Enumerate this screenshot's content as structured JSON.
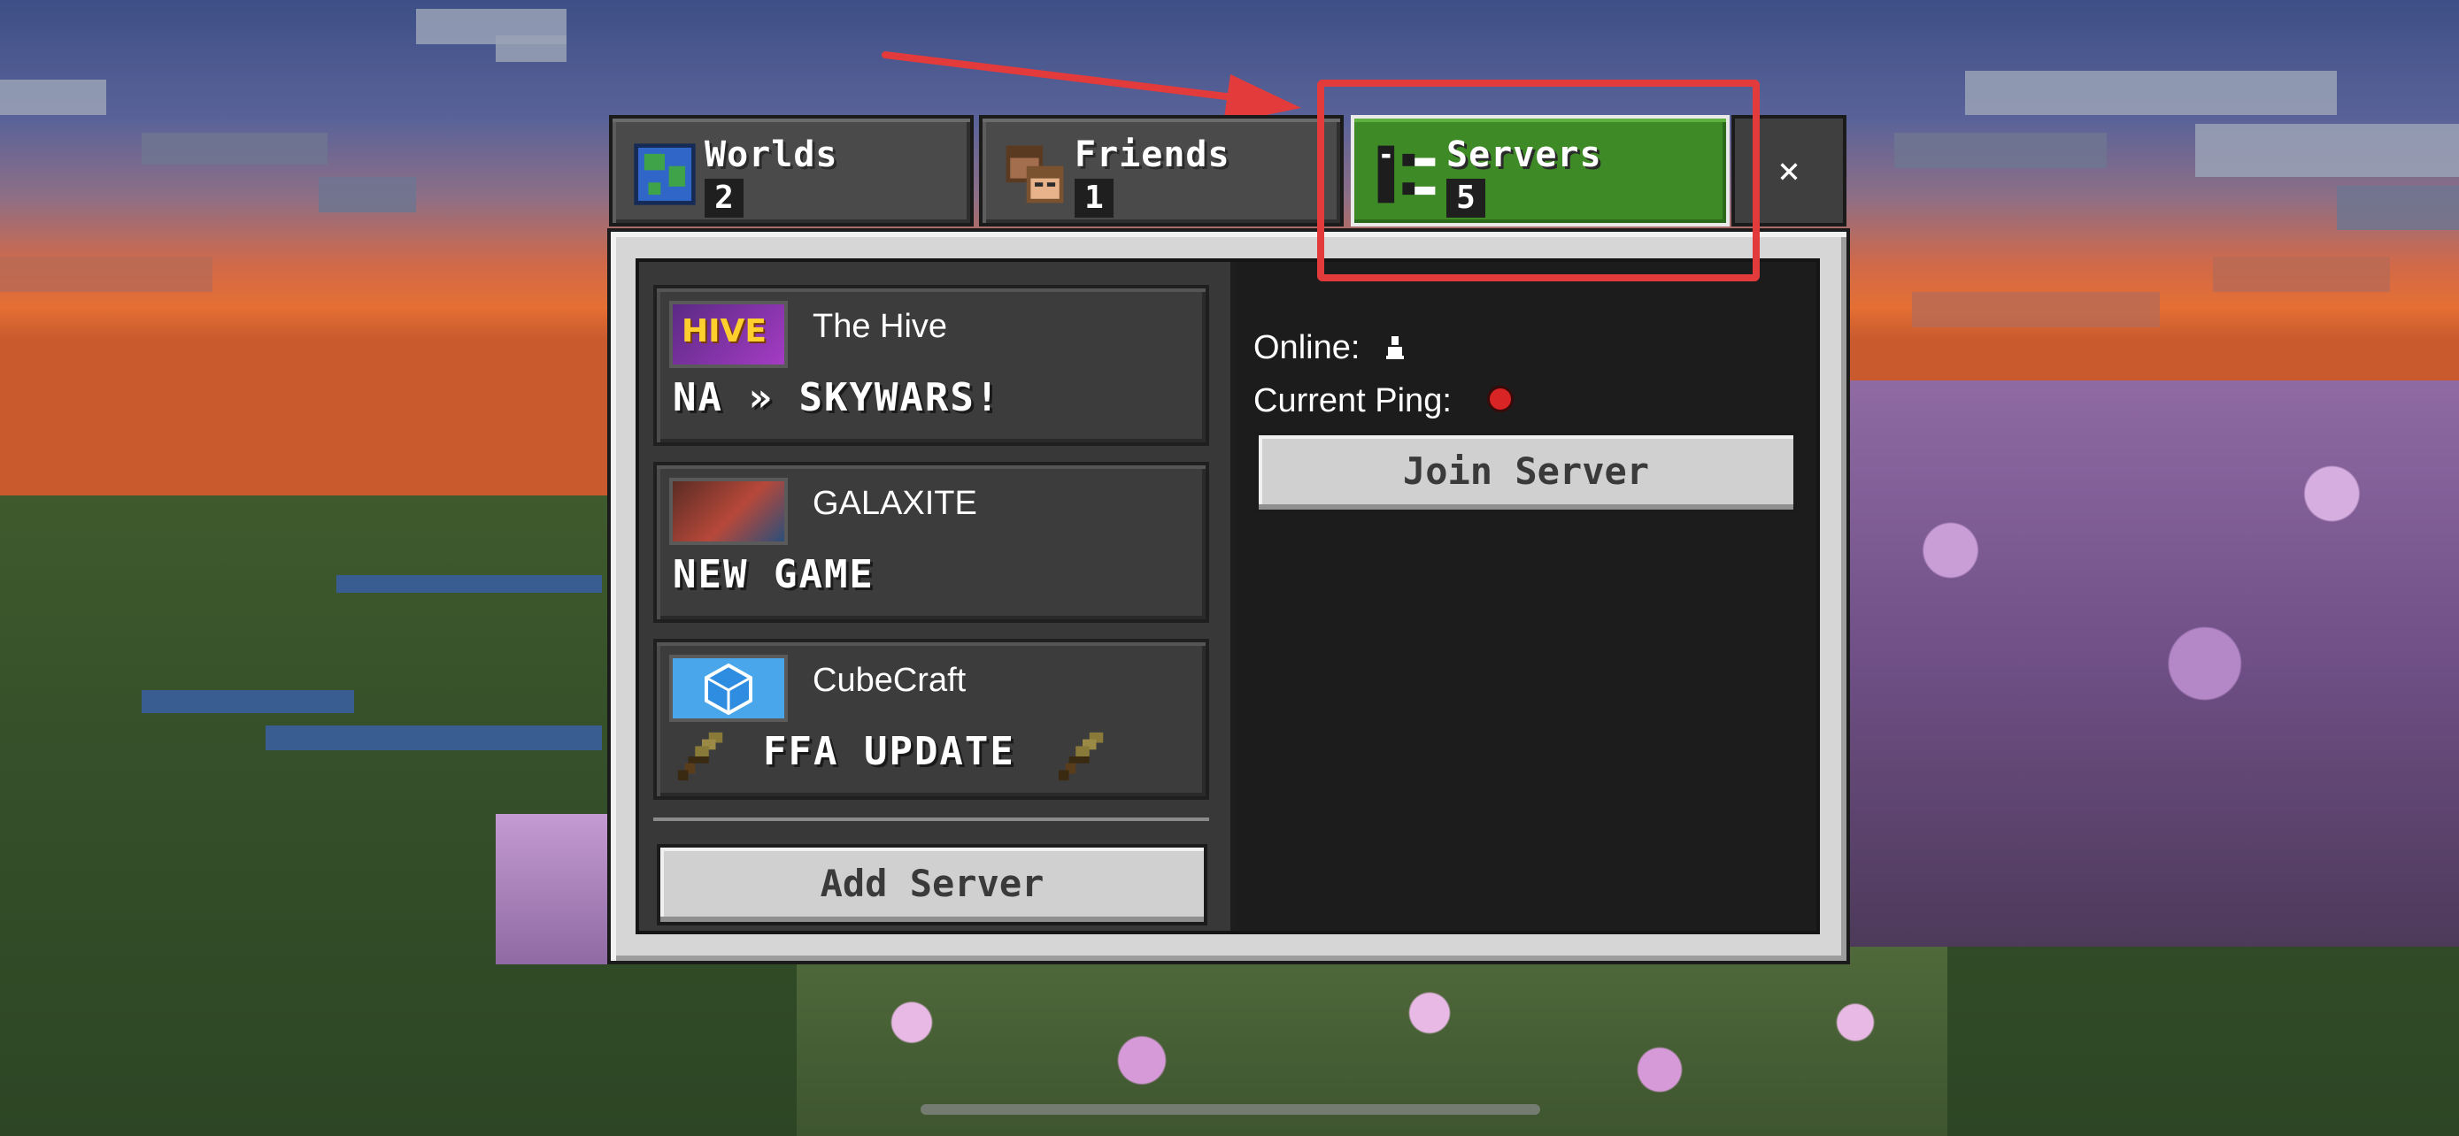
{
  "tabs": [
    {
      "id": "worlds",
      "label": "Worlds",
      "count": "2",
      "icon": "globe-icon"
    },
    {
      "id": "friends",
      "label": "Friends",
      "count": "1",
      "icon": "players-icon"
    },
    {
      "id": "servers",
      "label": "Servers",
      "count": "5",
      "icon": "server-icon",
      "selected": true
    }
  ],
  "close_label": "×",
  "servers": [
    {
      "name": "The Hive",
      "motd": "NA » SKYWARS!",
      "thumb_text": "HIVE"
    },
    {
      "name": "GALAXITE",
      "motd": "NEW GAME"
    },
    {
      "name": "CubeCraft",
      "motd": "FFA UPDATE",
      "motd_icons": "sword-icon"
    }
  ],
  "add_server_label": "Add Server",
  "detail": {
    "online_label": "Online:",
    "ping_label": "Current Ping:",
    "join_label": "Join Server"
  },
  "colors": {
    "selected_tab": "#3d8a26",
    "annotation": "#e33b3b",
    "ping_status": "#d82424"
  }
}
